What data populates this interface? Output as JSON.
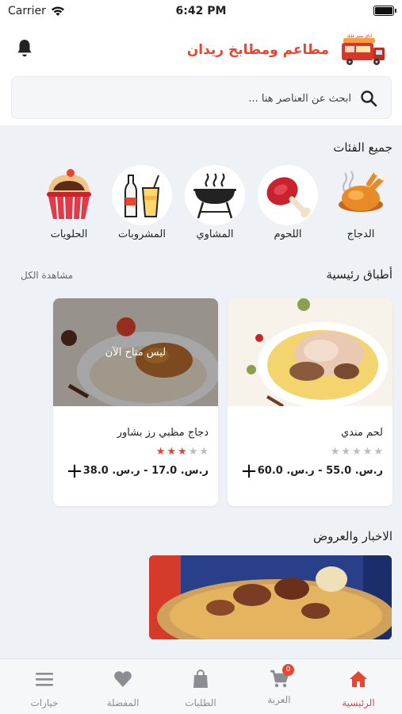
{
  "status_bar": {
    "carrier": "Carrier",
    "time": "6:42 PM"
  },
  "header": {
    "title": "مطاعم ومطابخ ريدان",
    "logo_text": "أذاق يسير فلبك"
  },
  "search": {
    "placeholder": "ابحث عن العناصر هنا ..."
  },
  "categories_section": {
    "title": "جميع الفئات",
    "items": [
      {
        "label": "الدجاج",
        "icon": "roast-chicken-icon"
      },
      {
        "label": "اللحوم",
        "icon": "meat-leg-icon"
      },
      {
        "label": "المشاوي",
        "icon": "grill-icon"
      },
      {
        "label": "المشروبات",
        "icon": "drinks-icon"
      },
      {
        "label": "الحلويات",
        "icon": "cupcake-icon"
      }
    ]
  },
  "main_dishes": {
    "title": "أطباق رئيسية",
    "see_all": "مشاهدة الكل",
    "items": [
      {
        "name": "لحم مندي",
        "price": "ر.س. 55.0 - ر.س. 60.0",
        "rating": 0,
        "available": true
      },
      {
        "name": "دجاج مظبي رز بشاور",
        "price": "ر.س. 17.0 - ر.س. 38.0",
        "rating": 3,
        "available": false,
        "unavailable_label": "ليس متاح الآن"
      }
    ]
  },
  "offers": {
    "title": "الاخبار والعروض"
  },
  "tabbar": {
    "items": [
      {
        "label": "الرئيسية",
        "icon": "home-icon",
        "active": true
      },
      {
        "label": "العربة",
        "icon": "cart-icon",
        "badge": "0"
      },
      {
        "label": "الطلبات",
        "icon": "shopping-bag-icon"
      },
      {
        "label": "المفضلة",
        "icon": "heart-icon"
      },
      {
        "label": "خيارات",
        "icon": "menu-icon"
      }
    ]
  },
  "colors": {
    "accent": "#e8452f",
    "inactive": "#8a8d93",
    "star_active": "#e8452f",
    "star_inactive": "#b9bcc2"
  }
}
